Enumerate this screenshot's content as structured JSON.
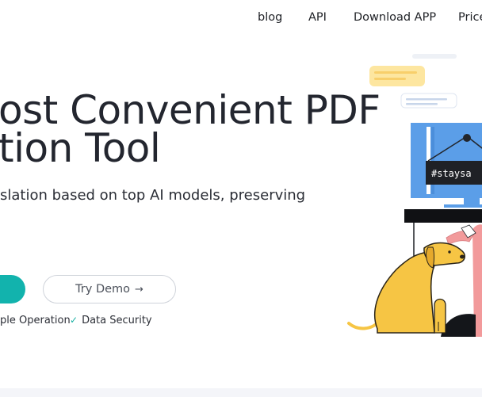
{
  "nav": {
    "items": [
      "blog",
      "API",
      "Download APP",
      "Price"
    ]
  },
  "hero": {
    "title_line1": "ost Convenient PDF",
    "title_line2": "tion Tool",
    "subtitle": "slation based on top AI models, preserving"
  },
  "actions": {
    "demo_label": "Try Demo",
    "demo_arrow": "→"
  },
  "features": [
    "ple Operation",
    "Data Security"
  ],
  "illustration": {
    "sign_text": "#staysa"
  },
  "colors": {
    "accent": "#12b3ad",
    "check": "#17b0a2",
    "monitor": "#5b9ee8",
    "dog": "#f6c544",
    "person_skin": "#f29a9b",
    "note_yellow": "#fde6a0"
  }
}
